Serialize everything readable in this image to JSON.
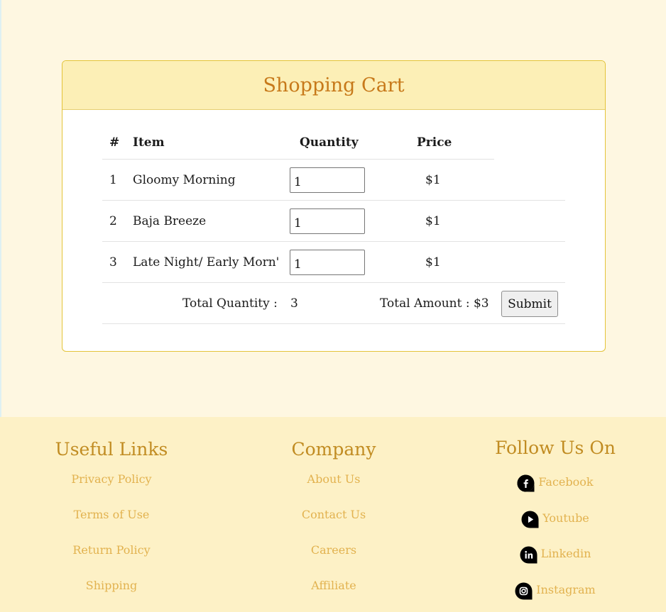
{
  "cart": {
    "title": "Shopping Cart",
    "columns": [
      "#",
      "Item",
      "Quantity",
      "Price"
    ],
    "items": [
      {
        "num": "1",
        "name": "Gloomy Morning",
        "qty": "1",
        "price": "$1"
      },
      {
        "num": "2",
        "name": "Baja Breeze",
        "qty": "1",
        "price": "$1"
      },
      {
        "num": "3",
        "name": "Late Night/ Early Morn'",
        "qty": "1",
        "price": "$1"
      }
    ],
    "total_quantity_label": "Total Quantity :",
    "total_quantity_value": "3",
    "total_amount_text": "Total Amount : $3",
    "submit_label": "Submit"
  },
  "footer": {
    "useful_links": {
      "heading": "Useful Links",
      "links": [
        "Privacy Policy",
        "Terms of Use",
        "Return Policy",
        "Shipping"
      ]
    },
    "company": {
      "heading": "Company",
      "links": [
        "About Us",
        "Contact Us",
        "Careers",
        "Affiliate"
      ]
    },
    "follow": {
      "heading": "Follow Us On",
      "links": [
        {
          "label": "Facebook",
          "icon": "facebook-icon"
        },
        {
          "label": "Youtube",
          "icon": "youtube-icon"
        },
        {
          "label": "Linkedin",
          "icon": "linkedin-icon"
        },
        {
          "label": "Instagram",
          "icon": "instagram-icon"
        }
      ]
    }
  },
  "colors": {
    "page_bg": "#fef7e1",
    "card_header_bg": "#fcefb6",
    "title": "#c7791a",
    "footer_bg": "#fdf1c6",
    "footer_heading": "#c18c22",
    "footer_link": "#e2b24f"
  }
}
